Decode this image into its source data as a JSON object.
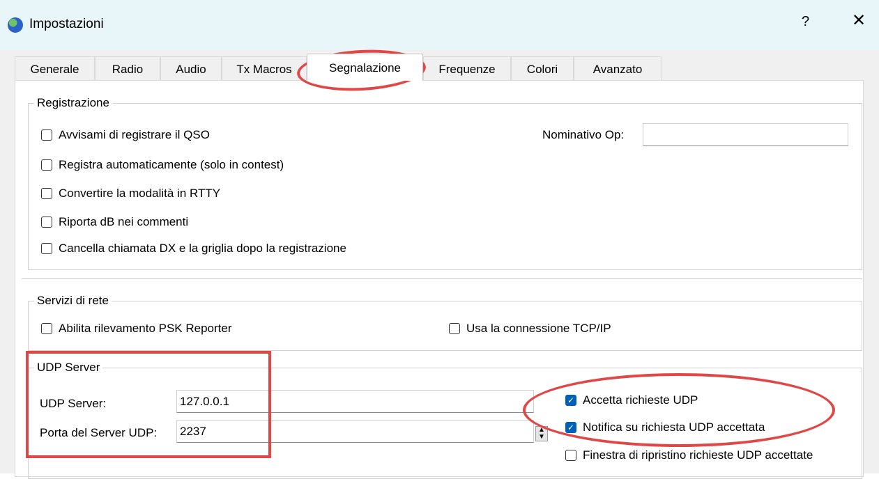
{
  "window": {
    "title": "Impostazioni",
    "help_label": "?",
    "close_label": "✕"
  },
  "tabs": [
    {
      "label": "Generale"
    },
    {
      "label": "Radio"
    },
    {
      "label": "Audio"
    },
    {
      "label": "Tx Macros"
    },
    {
      "label": "Segnalazione",
      "active": true
    },
    {
      "label": "Frequenze"
    },
    {
      "label": "Colori"
    },
    {
      "label": "Avanzato"
    }
  ],
  "registrazione": {
    "title": "Registrazione",
    "prompt_log": {
      "label": "Avvisami di registrare il QSO",
      "checked": false
    },
    "auto_log": {
      "label": "Registra automaticamente (solo in contest)",
      "checked": false
    },
    "rtty_mode": {
      "label": "Convertire la modalità in RTTY",
      "checked": false
    },
    "report_db": {
      "label": "Riporta dB nei commenti",
      "checked": false
    },
    "clear_dx": {
      "label": "Cancella chiamata DX e la griglia dopo la registrazione",
      "checked": false
    },
    "op_call_label": "Nominativo Op:",
    "op_call_value": ""
  },
  "servizi_rete": {
    "title": "Servizi di rete",
    "psk_reporter": {
      "label": "Abilita rilevamento PSK Reporter",
      "checked": false
    },
    "tcp_ip": {
      "label": "Usa la connessione TCP/IP",
      "checked": false
    }
  },
  "udp_server": {
    "title": "UDP Server",
    "server_label": "UDP Server:",
    "server_value": "127.0.0.1",
    "port_label": "Porta del Server UDP:",
    "port_value": "2237",
    "accept_requests": {
      "label": "Accetta richieste UDP",
      "checked": true
    },
    "notify_accepted": {
      "label": "Notifica su richiesta UDP accettata",
      "checked": true
    },
    "restore_window": {
      "label": "Finestra di ripristino richieste UDP accettate",
      "checked": false
    }
  },
  "colors": {
    "accent": "#005fb8",
    "annotation": "#e04848",
    "titlebar": "#e8f5f9"
  },
  "icons": {
    "app": "wsjt-globe-icon",
    "check": "checkmark-icon",
    "spinner": "spin-arrows-icon"
  }
}
